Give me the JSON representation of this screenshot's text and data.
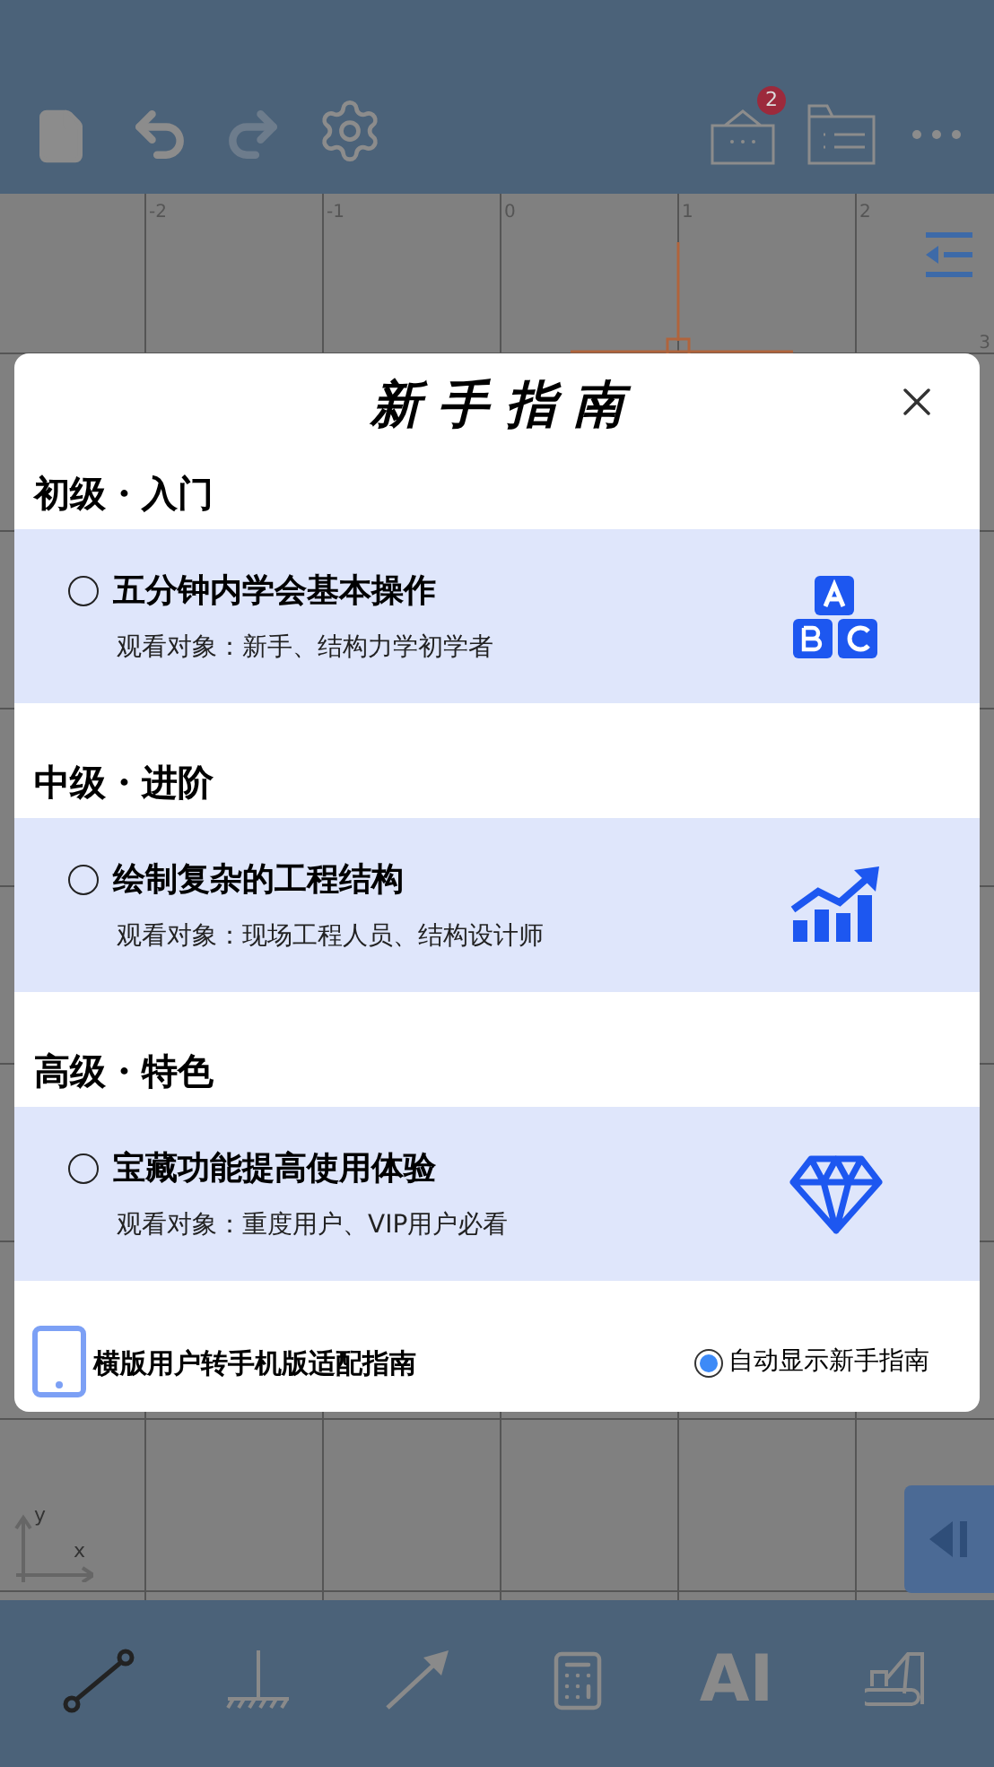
{
  "toolbar": {
    "badge": "2"
  },
  "canvas": {
    "axis_labels": [
      "-2",
      "-1",
      "0",
      "1",
      "2"
    ],
    "side_label": "3",
    "origin": {
      "x": "x",
      "y": "y"
    }
  },
  "dialog": {
    "title": "新 手 指 南",
    "sections": [
      {
        "heading": "初级・入门",
        "title": "五分钟内学会基本操作",
        "subtitle": "观看对象：新手、结构力学初学者",
        "kind": "blocks",
        "selected": false
      },
      {
        "heading": "中级・进阶",
        "title": "绘制复杂的工程结构",
        "subtitle": "观看对象：现场工程人员、结构设计师",
        "kind": "chart",
        "selected": false
      },
      {
        "heading": "高级・特色",
        "title": "宝藏功能提高使用体验",
        "subtitle": "观看对象：重度用户、VIP用户必看",
        "kind": "diamond",
        "selected": false
      }
    ],
    "footer_link": "横版用户转手机版适配指南",
    "auto_show": {
      "label": "自动显示新手指南",
      "checked": true
    }
  },
  "bottom_tools": [
    {
      "kind": "beam",
      "selected": true
    },
    {
      "kind": "support",
      "selected": false
    },
    {
      "kind": "load",
      "selected": false
    },
    {
      "kind": "calculator",
      "selected": false
    },
    {
      "kind": "text",
      "label": "AI",
      "selected": false
    },
    {
      "kind": "crane",
      "selected": false
    }
  ]
}
